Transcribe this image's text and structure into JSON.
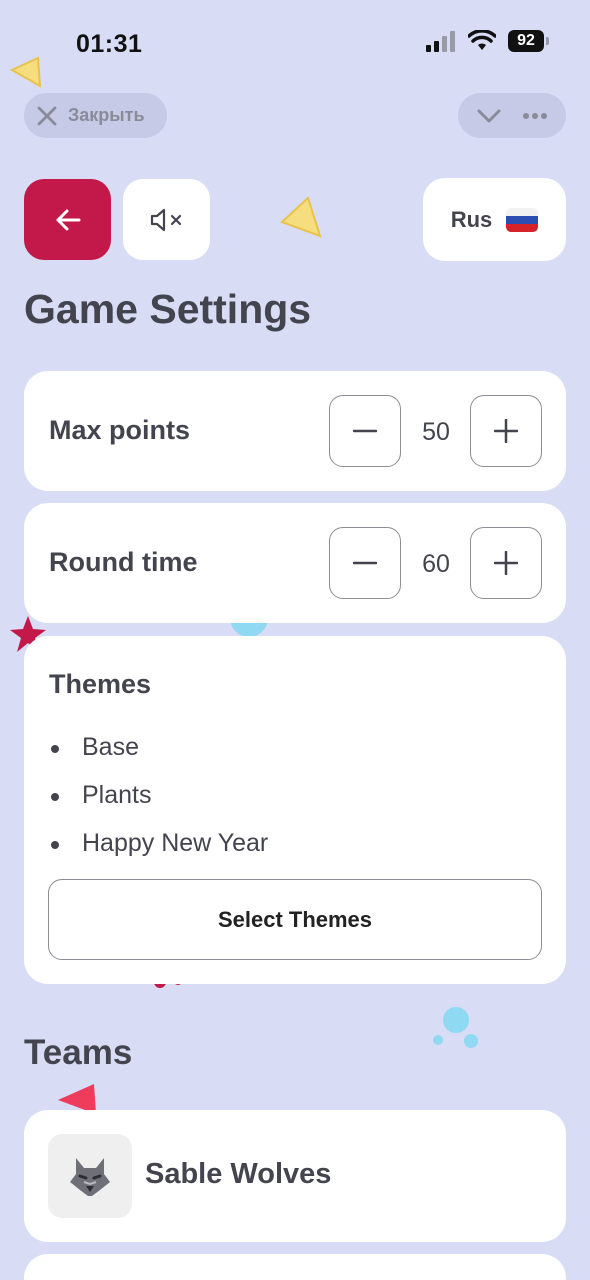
{
  "status_bar": {
    "time": "01:31",
    "battery": "92"
  },
  "top_bar": {
    "close_label": "Закрыть"
  },
  "language": {
    "label": "Rus"
  },
  "page_title": "Game Settings",
  "settings": [
    {
      "label": "Max points",
      "value": "50"
    },
    {
      "label": "Round time",
      "value": "60"
    }
  ],
  "themes": {
    "title": "Themes",
    "items": [
      "Base",
      "Plants",
      "Happy New Year"
    ],
    "select_label": "Select Themes"
  },
  "teams": {
    "title": "Teams",
    "items": [
      {
        "name": "Sable Wolves",
        "icon": "wolf-icon"
      }
    ]
  },
  "colors": {
    "background": "#d8dcf4",
    "accent": "#c2184a",
    "text": "#44444f"
  }
}
